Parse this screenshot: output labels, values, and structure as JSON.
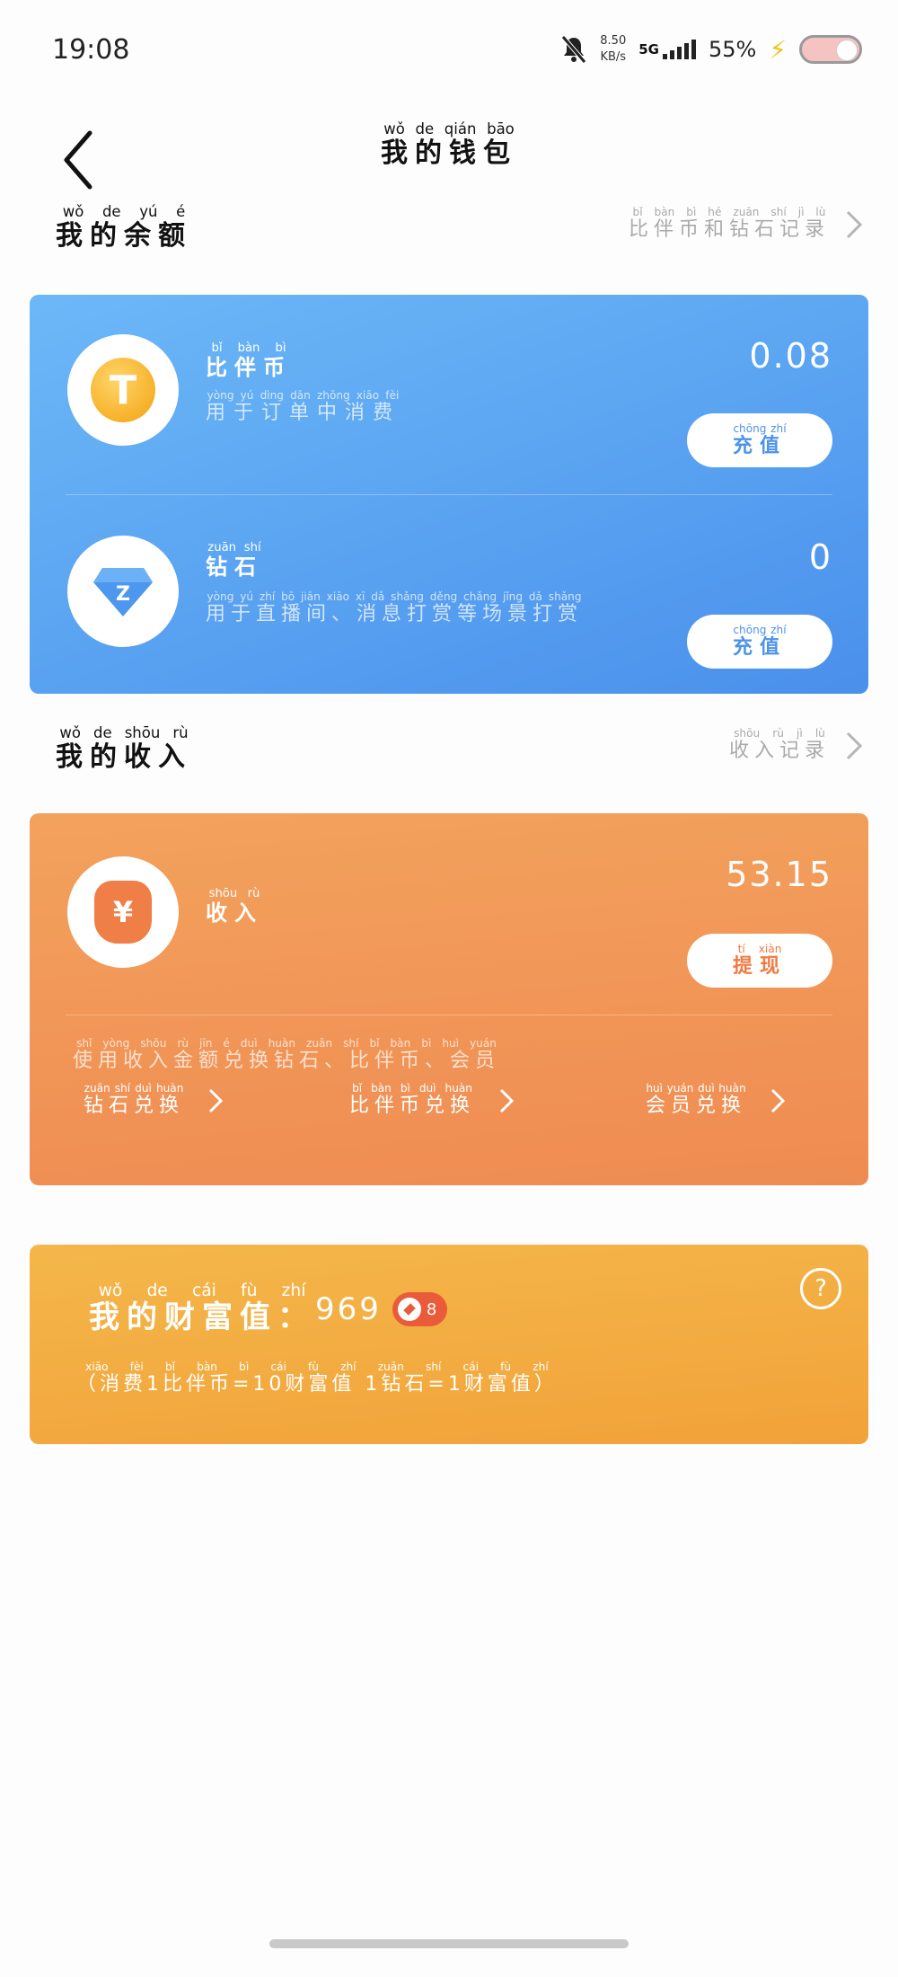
{
  "status": {
    "time": "19:08",
    "speed_value": "8.50",
    "speed_unit": "KB/s",
    "network": "5G",
    "battery": "55%"
  },
  "header": {
    "title": "我的钱包",
    "title_pinyin": "wǒ de qián bāo"
  },
  "balance": {
    "title": "我的余额",
    "title_pinyin": "wǒ de yú é",
    "record_link": "比伴币和钻石记录",
    "record_link_pinyin": "bǐ bàn bì hé zuān shí jì lù",
    "bibanbi": {
      "label": "比伴币",
      "label_pinyin": "bǐ bàn bì",
      "desc": "用于订单中消费",
      "desc_pinyin": "yòng yú dìng dān zhōng xiāo fèi",
      "amount": "0.08",
      "button": "充值",
      "button_pinyin": "chōng zhí"
    },
    "diamond": {
      "label": "钻石",
      "label_pinyin": "zuān shí",
      "desc": "用于直播间、消息打赏等场景打赏",
      "desc_pinyin": "yòng yú zhí bō jiān xiāo xī dǎ shǎng děng chǎng jǐng dǎ shǎng",
      "amount": "0",
      "button": "充值",
      "button_pinyin": "chōng zhí"
    }
  },
  "income": {
    "title": "我的收入",
    "title_pinyin": "wǒ de shōu rù",
    "record_link": "收入记录",
    "record_link_pinyin": "shōu rù jì lù",
    "label": "收入",
    "label_pinyin": "shōu rù",
    "amount": "53.15",
    "withdraw_button": "提现",
    "withdraw_button_pinyin": "tí xiàn",
    "note": "使用收入金额兑换钻石、比伴币、会员",
    "note_pinyin": "shǐ yòng shōu rù jīn é duì huàn zuān shí bǐ bàn bì huì yuán",
    "exchange": [
      {
        "label": "钻石兑换",
        "pinyin": "zuān shí duì huàn"
      },
      {
        "label": "比伴币兑换",
        "pinyin": "bǐ bàn bì duì huàn"
      },
      {
        "label": "会员兑换",
        "pinyin": "huì yuán duì huàn"
      }
    ]
  },
  "wealth": {
    "title": "我的财富值：",
    "title_pinyin": "wǒ de cái fù zhí",
    "value": "969",
    "level": "8",
    "note": "（消费1比伴币=10财富值 1钻石=1财富值）",
    "note_pinyin": "xiāo fèi bǐ bàn bì cái fù zhí zuān shí cái fù zhí",
    "help": "?"
  },
  "icons": {
    "coin": "T",
    "diamond": "Z",
    "money_bag": "¥"
  },
  "colors": {
    "blue_card": "#5aa2f2",
    "orange_card": "#f0955a",
    "gold_card": "#f3ac40"
  }
}
